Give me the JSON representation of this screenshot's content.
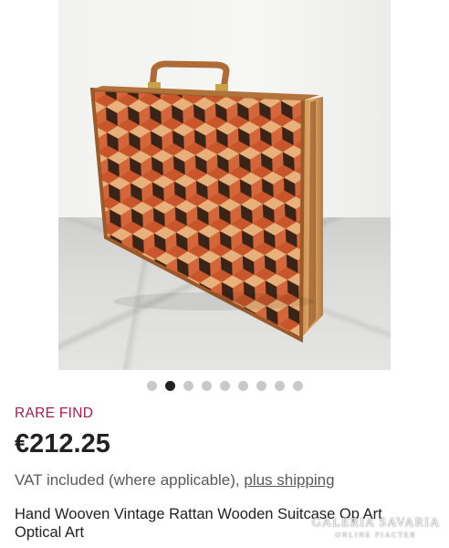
{
  "product": {
    "image_alt_icon": "rattan-suitcase-photo",
    "carousel": {
      "count": 9,
      "active_index": 1
    },
    "badge": "RARE FIND",
    "price": "€212.25",
    "vat_text": "VAT included (where applicable), ",
    "shipping_link": "plus shipping",
    "title": "Hand Wooven Vintage Rattan Wooden Suitcase Op Art Optical Art"
  },
  "watermark": {
    "line1": "GALERIA SAVARIA",
    "line2": "ONLINE PIACTER"
  },
  "colors": {
    "badge": "#a61c4b",
    "active_dot": "#222222",
    "dot": "#c9c9c9"
  }
}
